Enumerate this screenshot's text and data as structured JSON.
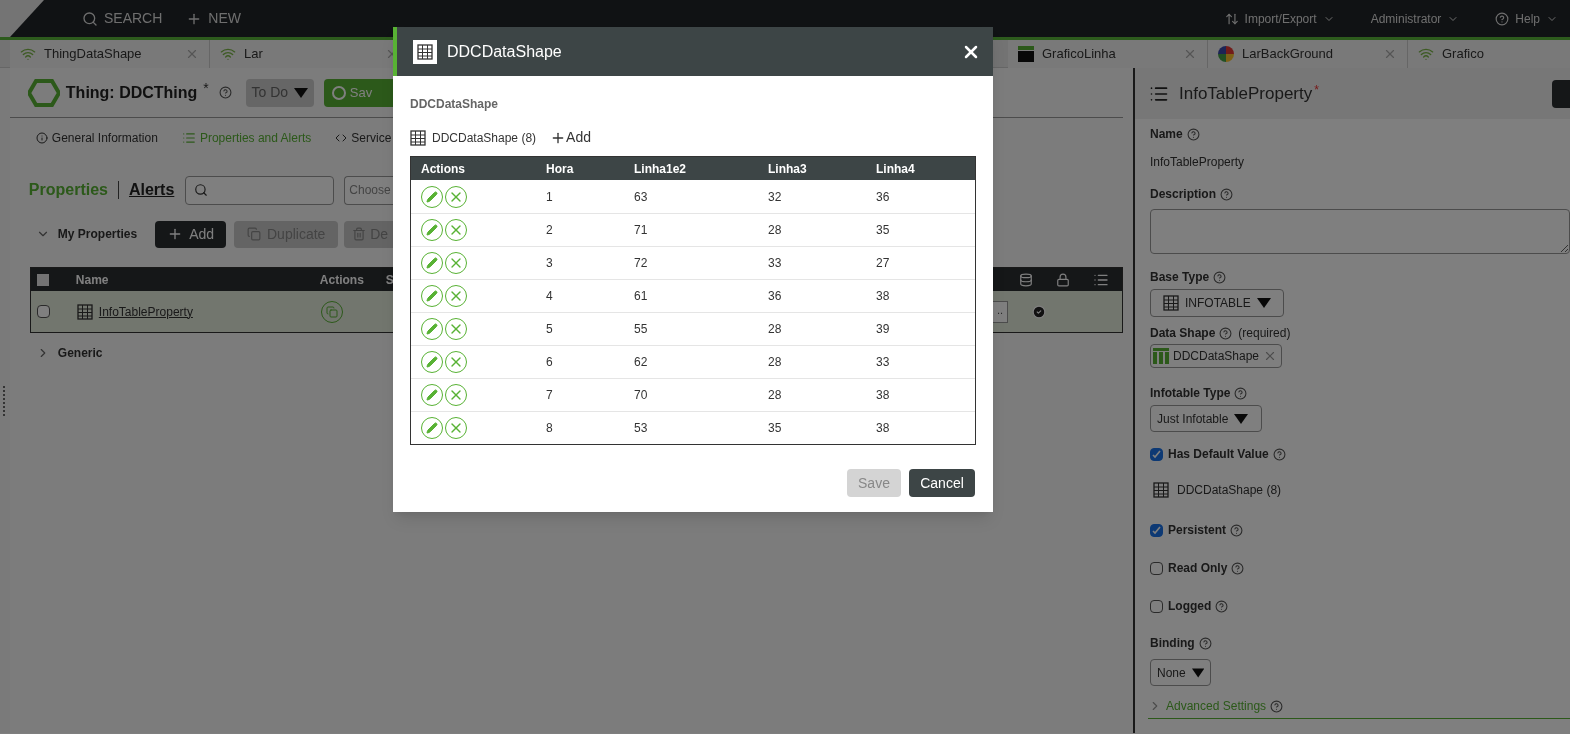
{
  "topbar": {
    "search": "SEARCH",
    "new": "NEW",
    "menus": [
      {
        "kind": "transfer",
        "label": "Import/Export"
      },
      {
        "kind": "user",
        "label": "Administrator"
      },
      {
        "kind": "help",
        "label": "Help"
      }
    ]
  },
  "tabs": [
    {
      "kind": "wifi",
      "label": "ThingDataShape",
      "closable": true
    },
    {
      "kind": "wifi",
      "label": "Lar",
      "closable": true
    },
    {
      "kind": "chart",
      "label": "GraficoLinha",
      "closable": true
    },
    {
      "kind": "wheel",
      "label": "LarBackGround",
      "closable": true
    },
    {
      "kind": "wifi",
      "label": "Grafico"
    }
  ],
  "thing": {
    "title": "Thing: DDCThing",
    "modified": "*",
    "state_button": "To Do",
    "save_button": "Sav"
  },
  "nav": [
    {
      "kind": "info",
      "label": "General Information",
      "selected": false
    },
    {
      "kind": "list",
      "label": "Properties and Alerts",
      "selected": true
    },
    {
      "kind": "code",
      "label": "Service",
      "selected": false
    }
  ],
  "section_tabs": [
    {
      "label": "Properties",
      "selected": true
    },
    {
      "label": "Alerts",
      "selected": false
    }
  ],
  "filter": {
    "placeholder": "Choose"
  },
  "group": {
    "label": "My Properties",
    "expanded": true,
    "add": "Add",
    "duplicate": "Duplicate",
    "delete": "De"
  },
  "property_table": {
    "all_checked": false,
    "columns": [
      "Name",
      "Actions",
      "S"
    ],
    "rows": [
      {
        "name": "InfoTableProperty",
        "checked": false,
        "selected": true,
        "more": "..",
        "persistent": true
      }
    ]
  },
  "generic": {
    "label": "Generic",
    "expanded": false
  },
  "panel": {
    "title": "InfoTableProperty",
    "required_mark": "*",
    "name_label": "Name",
    "name_value": "InfoTableProperty",
    "description_label": "Description",
    "base_type_label": "Base Type",
    "base_type": "INFOTABLE",
    "data_shape_label": "Data Shape",
    "data_shape_note": "(required)",
    "data_shape": "DDCDataShape",
    "infotable_type_label": "Infotable Type",
    "infotable_type": "Just Infotable",
    "checks": [
      {
        "label": "Has Default Value",
        "checked": true
      },
      {
        "label": "Persistent",
        "checked": true
      },
      {
        "label": "Read Only",
        "checked": false
      },
      {
        "label": "Logged",
        "checked": false
      }
    ],
    "default_value": "DDCDataShape (8)",
    "binding_label": "Binding",
    "binding": "None",
    "advanced": "Advanced Settings"
  },
  "modal": {
    "title": "DDCDataShape",
    "subtitle": "DDCDataShape",
    "infotable": "DDCDataShape (8)",
    "add": "Add",
    "columns": [
      "Actions",
      "Hora",
      "Linha1e2",
      "Linha3",
      "Linha4"
    ],
    "rows": [
      [
        "",
        "1",
        "63",
        "32",
        "36"
      ],
      [
        "",
        "2",
        "71",
        "28",
        "35"
      ],
      [
        "",
        "3",
        "72",
        "33",
        "27"
      ],
      [
        "",
        "4",
        "61",
        "36",
        "38"
      ],
      [
        "",
        "5",
        "55",
        "28",
        "39"
      ],
      [
        "",
        "6",
        "62",
        "28",
        "33"
      ],
      [
        "",
        "7",
        "70",
        "28",
        "38"
      ],
      [
        "",
        "8",
        "53",
        "35",
        "38"
      ]
    ],
    "save": {
      "label": "Save",
      "disabled": true
    },
    "cancel": "Cancel"
  }
}
